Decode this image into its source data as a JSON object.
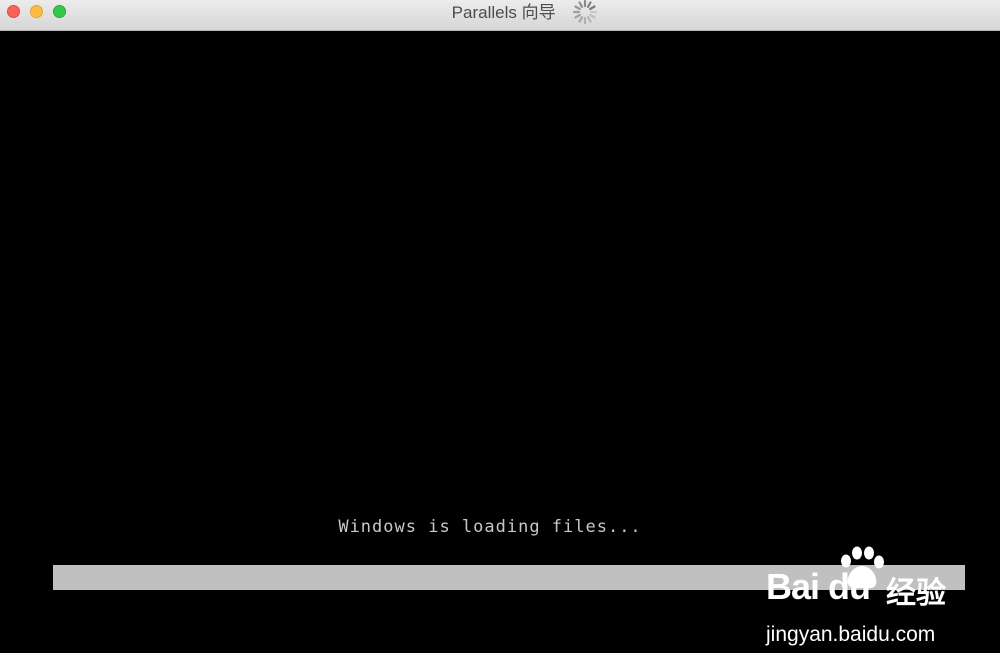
{
  "window": {
    "title": "Parallels 向导"
  },
  "screen": {
    "boot_message": "Windows is loading files...",
    "progress_fraction": 1.0
  },
  "watermark": {
    "brand": "Bai  du",
    "brand_cn": "经验",
    "url": "jingyan.baidu.com"
  },
  "colors": {
    "close": "#fc605b",
    "minimize": "#fdbc40",
    "maximize": "#34c84a",
    "progress": "#c0c0c0",
    "boot_text": "#c8c8c8"
  },
  "icons": {
    "spinner": "loading-spinner-icon",
    "paw": "baidu-paw-icon"
  }
}
